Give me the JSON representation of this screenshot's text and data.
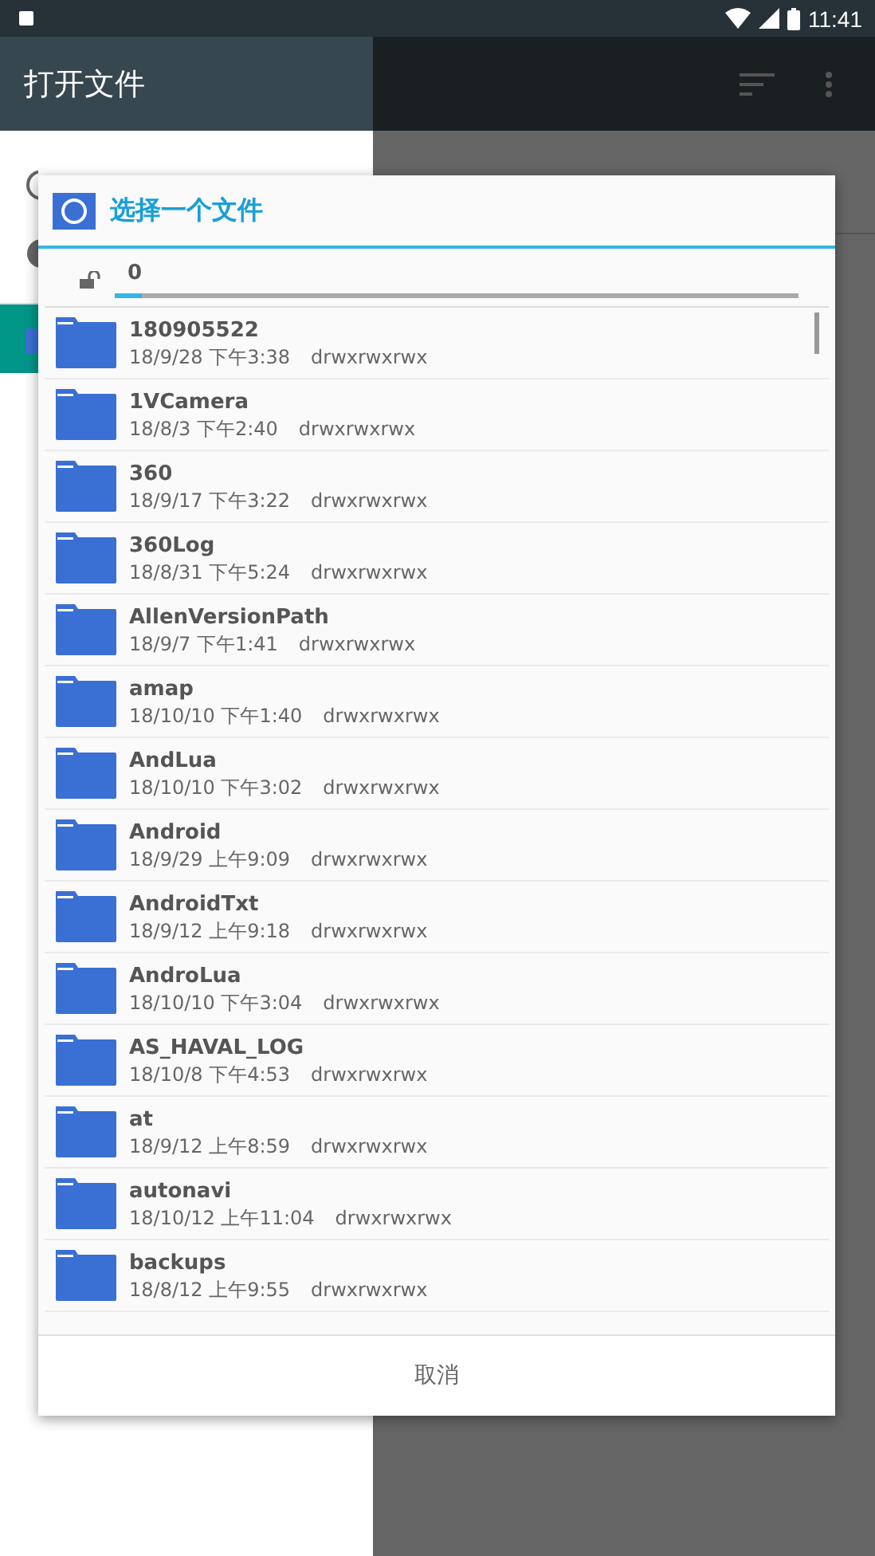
{
  "status_bar": {
    "time": "11:41"
  },
  "app_bar": {
    "title": "打开文件"
  },
  "drawer": {
    "items": [
      {
        "selected": false
      },
      {
        "selected": false
      },
      {
        "selected": true
      }
    ]
  },
  "dialog": {
    "title": "选择一个文件",
    "path": {
      "text": "0",
      "level": 0.04
    },
    "files": [
      {
        "name": "180905522",
        "date": "18/9/28 下午3:38",
        "perms": "drwxrwxrwx"
      },
      {
        "name": "1VCamera",
        "date": "18/8/3 下午2:40",
        "perms": "drwxrwxrwx"
      },
      {
        "name": "360",
        "date": "18/9/17 下午3:22",
        "perms": "drwxrwxrwx"
      },
      {
        "name": "360Log",
        "date": "18/8/31 下午5:24",
        "perms": "drwxrwxrwx"
      },
      {
        "name": "AllenVersionPath",
        "date": "18/9/7 下午1:41",
        "perms": "drwxrwxrwx"
      },
      {
        "name": "amap",
        "date": "18/10/10 下午1:40",
        "perms": "drwxrwxrwx"
      },
      {
        "name": "AndLua",
        "date": "18/10/10 下午3:02",
        "perms": "drwxrwxrwx"
      },
      {
        "name": "Android",
        "date": "18/9/29 上午9:09",
        "perms": "drwxrwxrwx"
      },
      {
        "name": "AndroidTxt",
        "date": "18/9/12 上午9:18",
        "perms": "drwxrwxrwx"
      },
      {
        "name": "AndroLua",
        "date": "18/10/10 下午3:04",
        "perms": "drwxrwxrwx"
      },
      {
        "name": "AS_HAVAL_LOG",
        "date": "18/10/8 下午4:53",
        "perms": "drwxrwxrwx"
      },
      {
        "name": "at",
        "date": "18/9/12 上午8:59",
        "perms": "drwxrwxrwx"
      },
      {
        "name": "autonavi",
        "date": "18/10/12 上午11:04",
        "perms": "drwxrwxrwx"
      },
      {
        "name": "backups",
        "date": "18/8/12 上午9:55",
        "perms": "drwxrwxrwx"
      }
    ],
    "cancel": "取消"
  }
}
